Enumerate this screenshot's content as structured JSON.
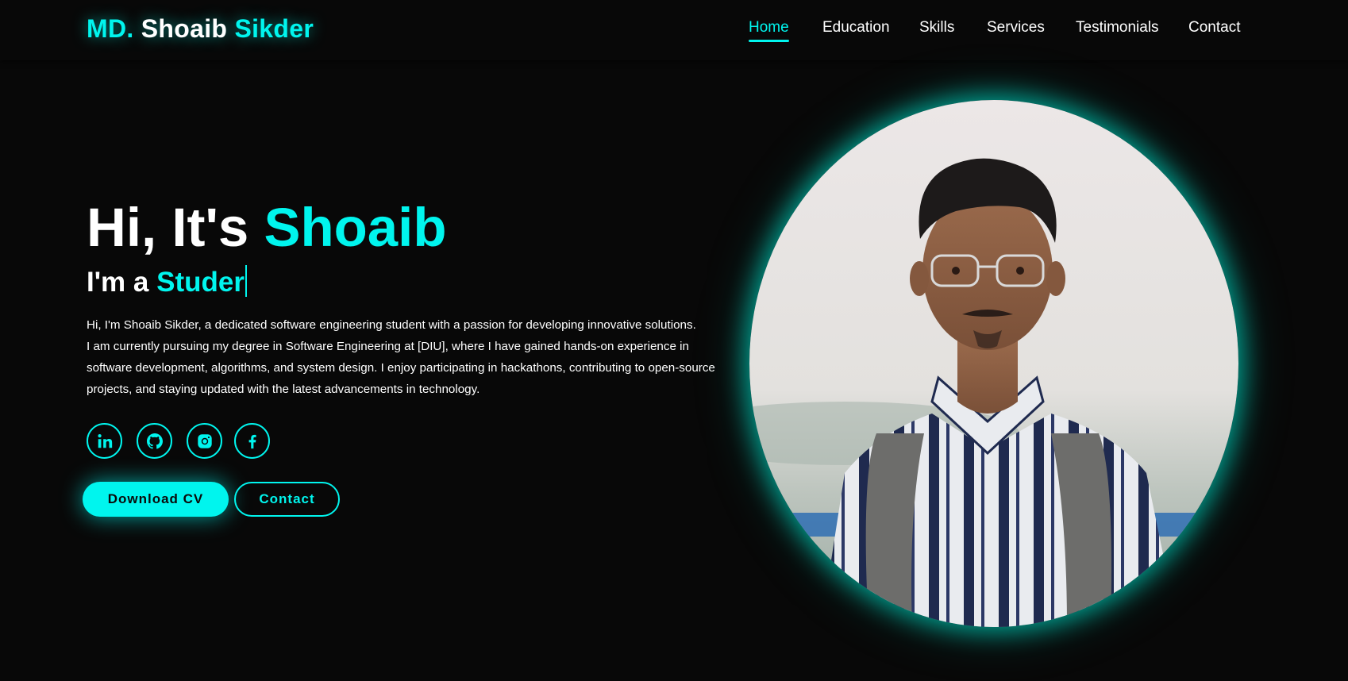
{
  "logo": {
    "part1": "MD.",
    "part2": "Shoaib",
    "part3": "Sikder"
  },
  "nav": {
    "items": [
      {
        "label": "Home",
        "active": true
      },
      {
        "label": "Education"
      },
      {
        "label": "Skills"
      },
      {
        "label": "Services"
      },
      {
        "label": "Testimonials"
      },
      {
        "label": "Contact"
      }
    ]
  },
  "hero": {
    "greeting": "Hi, It's",
    "name": "Shoaib",
    "role_prefix": "I'm a",
    "role_typed": "Studer",
    "description": [
      "Hi, I'm Shoaib Sikder, a dedicated software engineering student with a passion for developing innovative solutions.",
      "I am currently pursuing my degree in Software Engineering at [DIU], where I have gained hands-on experience in",
      "software development, algorithms, and system design. I enjoy participating in hackathons, contributing to open-source",
      "projects, and staying updated with the latest advancements in technology."
    ]
  },
  "socials": [
    {
      "icon": "linkedin-icon"
    },
    {
      "icon": "github-icon"
    },
    {
      "icon": "instagram-icon"
    },
    {
      "icon": "facebook-icon"
    }
  ],
  "buttons": {
    "download_cv": "Download CV",
    "contact": "Contact"
  },
  "colors": {
    "accent": "#00f5ee",
    "background": "#080808",
    "text": "#ffffff"
  }
}
